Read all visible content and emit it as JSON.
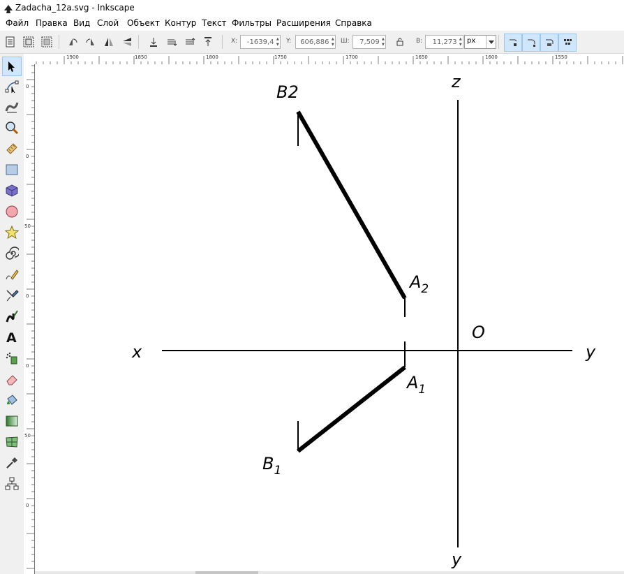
{
  "window": {
    "title": "Zadacha_12a.svg - Inkscape"
  },
  "menu": [
    "Файл",
    "Правка",
    "Вид",
    "Слой",
    "Объект",
    "Контур",
    "Текст",
    "Фильтры",
    "Расширения",
    "Справка"
  ],
  "toolbar": {
    "x": {
      "label": "X:",
      "value": "-1639,4"
    },
    "y": {
      "label": "Y:",
      "value": "606,886"
    },
    "w": {
      "label": "Ш:",
      "value": "7,509"
    },
    "h": {
      "label": "В:",
      "value": "11,273"
    },
    "unit": "px"
  },
  "ruler": {
    "h_labels": [
      "1900",
      "1850",
      "1800",
      "1750",
      "1700",
      "1650",
      "1600",
      "1550"
    ],
    "v_labels": [
      "0",
      "0",
      "50",
      "0",
      "0",
      "50",
      "0",
      "50",
      "0"
    ]
  },
  "drawing": {
    "axis_z": "z",
    "axis_x": "x",
    "axis_y_right": "y",
    "axis_y_bottom": "y",
    "origin": "O",
    "B2": {
      "letter": "B",
      "sub": "2"
    },
    "A2": {
      "letter": "A",
      "sub": "2"
    },
    "A1": {
      "letter": "A",
      "sub": "1"
    },
    "B1": {
      "letter": "B",
      "sub": "1"
    }
  },
  "icons": {
    "app": "inkscape-logo-icon",
    "tools": [
      "selector-icon",
      "node-icon",
      "tweak-icon",
      "zoom-icon",
      "measure-icon",
      "rect-icon",
      "box3d-icon",
      "ellipse-icon",
      "star-icon",
      "spiral-icon",
      "pencil-icon",
      "pen-icon",
      "calligraphy-icon",
      "text-icon",
      "spray-icon",
      "eraser-icon",
      "bucket-icon",
      "gradient-icon",
      "mesh-icon",
      "dropper-icon",
      "connector-icon"
    ]
  },
  "colors": {
    "snap_active": "#cfe6fb",
    "canvas": "#ffffff"
  }
}
